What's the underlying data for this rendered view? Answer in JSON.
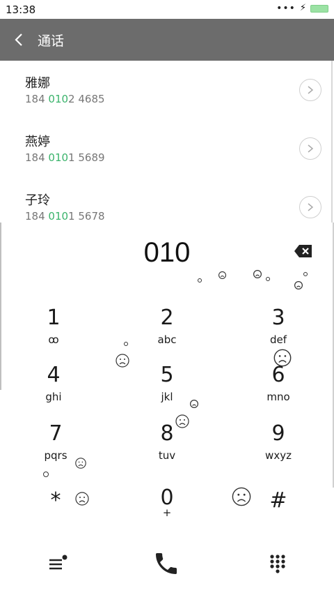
{
  "status": {
    "time": "13:38",
    "dots": "•••",
    "bolt": "⚡"
  },
  "header": {
    "title": "通话"
  },
  "contacts": [
    {
      "name": "雅娜",
      "number_pre": "184 ",
      "number_hl": "010",
      "number_post": "2 4685"
    },
    {
      "name": "燕婷",
      "number_pre": "184 ",
      "number_hl": "010",
      "number_post": "1 5689"
    },
    {
      "name": "子玲",
      "number_pre": "184 ",
      "number_hl": "010",
      "number_post": "1 5678"
    }
  ],
  "dial": {
    "number": "010"
  },
  "keypad": [
    {
      "digit": "1",
      "letters": "ꝏ"
    },
    {
      "digit": "2",
      "letters": "abc"
    },
    {
      "digit": "3",
      "letters": "def"
    },
    {
      "digit": "4",
      "letters": "ghi"
    },
    {
      "digit": "5",
      "letters": "jkl"
    },
    {
      "digit": "6",
      "letters": "mno"
    },
    {
      "digit": "7",
      "letters": "pqrs"
    },
    {
      "digit": "8",
      "letters": "tuv"
    },
    {
      "digit": "9",
      "letters": "wxyz"
    },
    {
      "digit": "*",
      "letters": ""
    },
    {
      "digit": "0",
      "letters": "+"
    },
    {
      "digit": "#",
      "letters": ""
    }
  ],
  "icons": {
    "back": "chevron-left-icon",
    "contact_arrow": "chevron-right-icon",
    "backspace": "backspace-icon",
    "menu": "menu-icon",
    "call": "phone-icon",
    "dialpad": "dialpad-icon"
  },
  "colors": {
    "header_bg": "#6c6c6c",
    "match_highlight": "#3ab36b",
    "battery": "#9be2a4"
  }
}
